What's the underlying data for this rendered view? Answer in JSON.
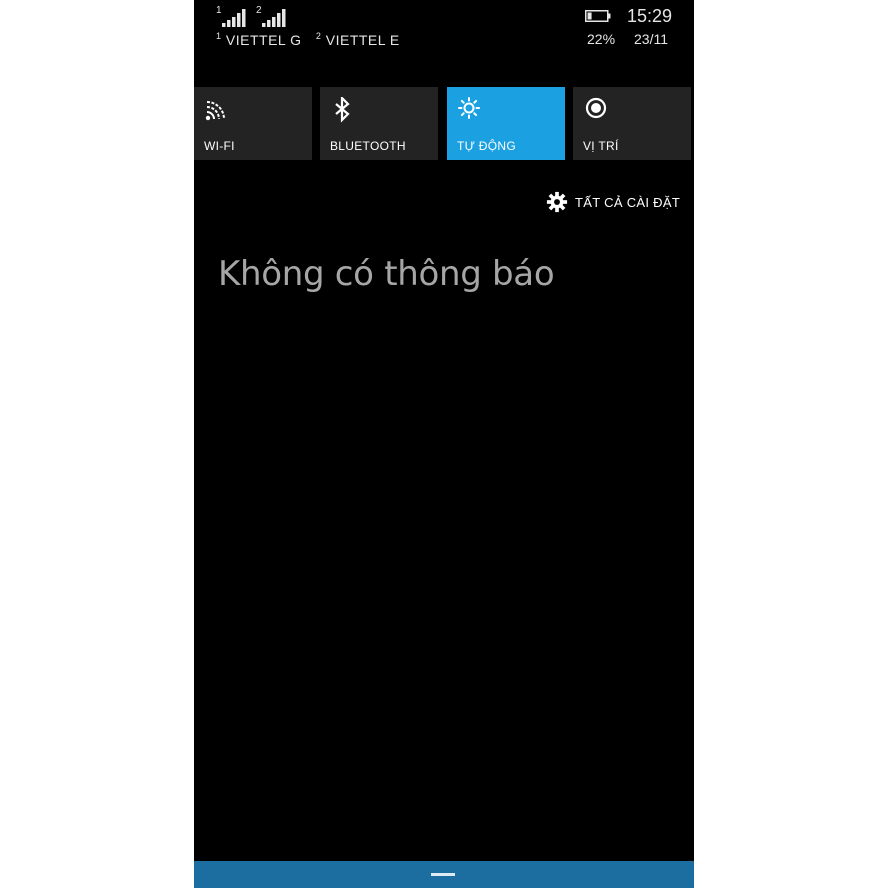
{
  "status_bar": {
    "sim1_number": "1",
    "sim2_number": "2",
    "carrier1": "VIETTEL G",
    "carrier2": "VIETTEL E",
    "battery_percent": "22%",
    "battery_level": 0.22,
    "time": "15:29",
    "date": "23/11",
    "signal_bars": {
      "sim1": 5,
      "sim2": 5
    }
  },
  "quick_actions": [
    {
      "label": "WI-FI",
      "icon": "wifi-icon",
      "active": false
    },
    {
      "label": "BLUETOOTH",
      "icon": "bluetooth-icon",
      "active": false
    },
    {
      "label": "TỰ ĐỘNG",
      "icon": "brightness-icon",
      "active": true
    },
    {
      "label": "VỊ TRÍ",
      "icon": "location-icon",
      "active": false
    }
  ],
  "all_settings": {
    "label": "TẤT CẢ CÀI ĐẶT",
    "icon": "gear-icon"
  },
  "notifications": {
    "empty_message": "Không có thông báo"
  },
  "colors": {
    "background": "#000000",
    "tile": "#232323",
    "accent": "#1ba1e2",
    "bottom_bar": "#1d6ea0",
    "empty_text": "#a6a6a6"
  }
}
